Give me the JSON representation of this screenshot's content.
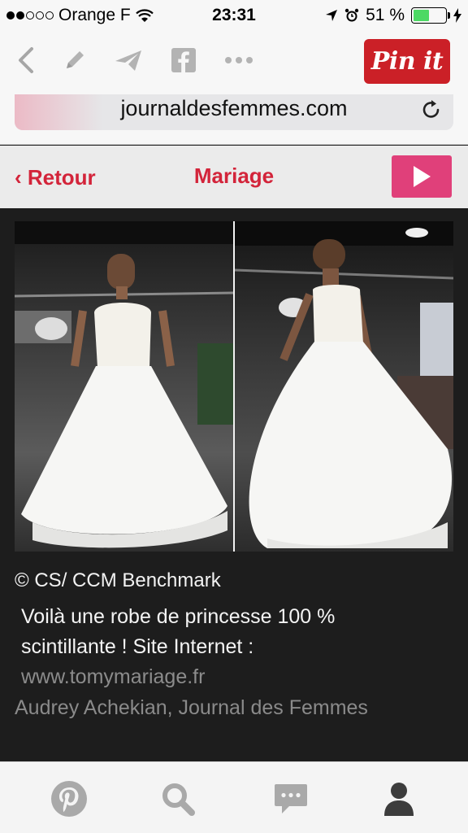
{
  "status_bar": {
    "carrier": "Orange F",
    "time": "23:31",
    "battery": "51 %",
    "battery_level": 0.51
  },
  "toolbar": {
    "icons": [
      "back-icon",
      "pencil-icon",
      "send-icon",
      "facebook-icon",
      "more-icon"
    ],
    "pin_label": "Pin it"
  },
  "address": {
    "url": "journaldesfemmes.com",
    "load_progress": 0.2
  },
  "site_nav": {
    "back_label": "‹ Retour",
    "title": "Mariage"
  },
  "article": {
    "credit": "© CS/ CCM Benchmark",
    "caption": "Voilà une robe de princesse 100 % scintillante ! Site Internet :",
    "link": "www.tomymariage.fr",
    "author": "Audrey Achekian, Journal des Femmes"
  },
  "tabbar": {
    "items": [
      "pinterest-icon",
      "search-icon",
      "chat-icon",
      "profile-icon"
    ]
  },
  "colors": {
    "accent_red": "#d3243a",
    "pin_red": "#cb2027",
    "play_pink": "#e0407a",
    "battery_green": "#4cd964"
  }
}
